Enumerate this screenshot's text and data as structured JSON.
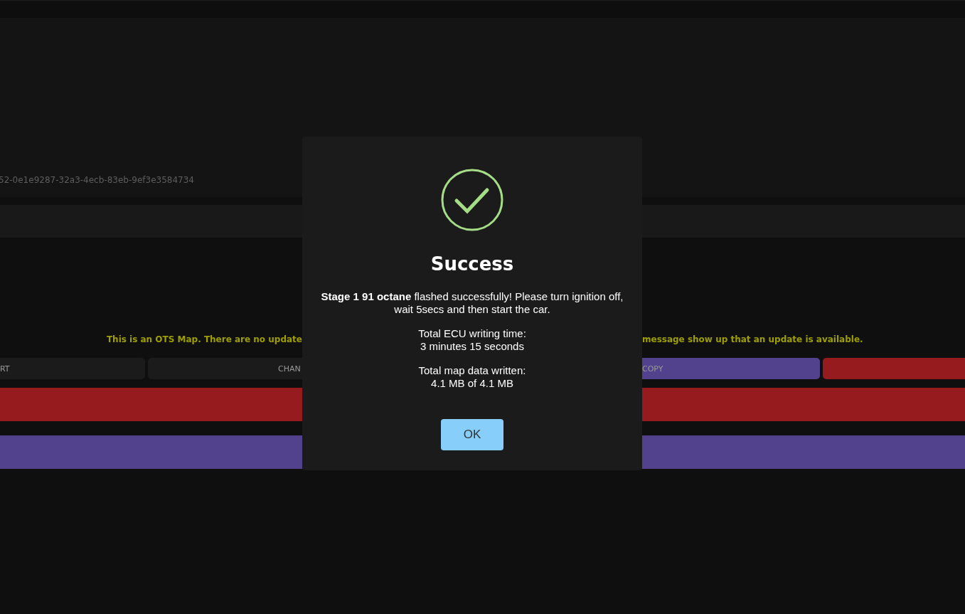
{
  "page": {
    "id_text": "52-0e1e9287-32a3-4ecb-83eb-9ef3e3584734",
    "notice_parts": [
      "This is an OTS Map. There are no update",
      "message show up that an update is available."
    ],
    "buttons": [
      {
        "label": "RT",
        "color": "#1b1b1b"
      },
      {
        "label": "CHAN",
        "color": "#1b1b1b"
      },
      {
        "label": "COPY",
        "color": "#52418c"
      },
      {
        "color": "#961b1e"
      }
    ],
    "bars": [
      {
        "color": "#961b1e"
      },
      {
        "color": "#52418c"
      }
    ]
  },
  "dialog": {
    "title": "Success",
    "message": "**Stage 1 91 octane** flashed successfully! Please turn ignition off, wait 5secs and then start the car.",
    "stats": [
      {
        "label": "Total ECU writing time:",
        "value": "3 minutes 15 seconds"
      },
      {
        "label": "Total map data written:",
        "value": "4.1 MB of 4.1 MB"
      }
    ],
    "ok_button": "OK"
  }
}
